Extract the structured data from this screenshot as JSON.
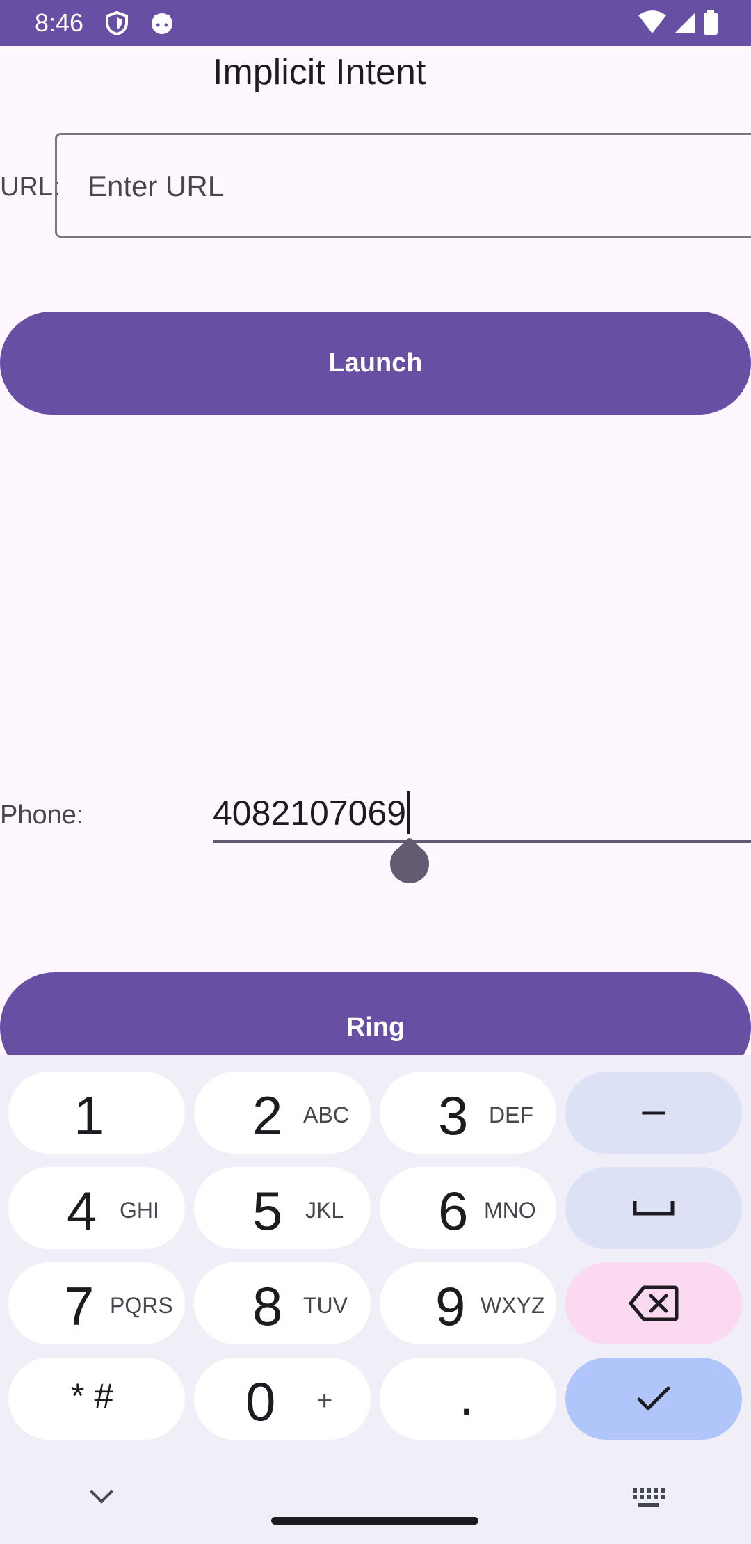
{
  "status_bar": {
    "time": "8:46",
    "icons": [
      "shield-icon",
      "android-head-icon",
      "wifi-icon",
      "cell-signal-icon",
      "battery-icon"
    ],
    "bg_color": "#6750a4"
  },
  "header": {
    "title": "Implicit Intent"
  },
  "url_row": {
    "label": "URL:",
    "placeholder": "Enter URL",
    "value": ""
  },
  "launch_button": {
    "label": "Launch"
  },
  "phone_row": {
    "label": "Phone:",
    "value": "4082107069"
  },
  "ring_button": {
    "label": "Ring"
  },
  "keyboard": {
    "rows": [
      [
        {
          "digit": "1",
          "letters": ""
        },
        {
          "digit": "2",
          "letters": "ABC"
        },
        {
          "digit": "3",
          "letters": "DEF"
        },
        {
          "symbol": "–"
        }
      ],
      [
        {
          "digit": "4",
          "letters": "GHI"
        },
        {
          "digit": "5",
          "letters": "JKL"
        },
        {
          "digit": "6",
          "letters": "MNO"
        },
        {
          "symbol": "space"
        }
      ],
      [
        {
          "digit": "7",
          "letters": "PQRS"
        },
        {
          "digit": "8",
          "letters": "TUV"
        },
        {
          "digit": "9",
          "letters": "WXYZ"
        },
        {
          "symbol": "backspace"
        }
      ],
      [
        {
          "digit": "* #",
          "letters": ""
        },
        {
          "digit": "0",
          "letters": "+"
        },
        {
          "digit": ".",
          "letters": ""
        },
        {
          "symbol": "done"
        }
      ]
    ]
  },
  "colors": {
    "primary": "#6750a4",
    "background": "#fef7ff"
  }
}
